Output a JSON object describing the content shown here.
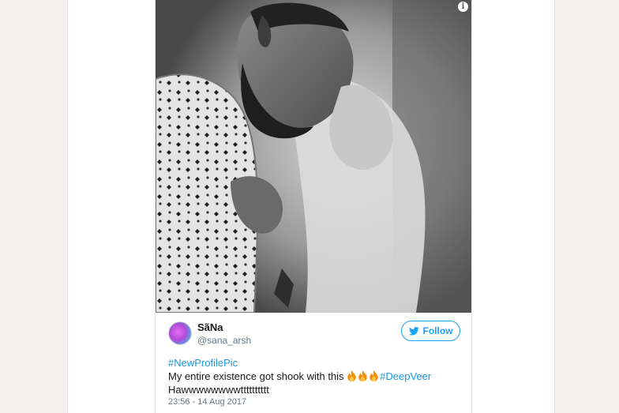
{
  "tweet": {
    "author": {
      "display_name": "SãNa",
      "handle": "@sana_arsh"
    },
    "follow_label": "Follow",
    "text": {
      "hashtag_1": "#NewProfilePic",
      "line_2": "My entire existence got shook with this ",
      "emoji": [
        "fire-icon",
        "fire-icon",
        "fire-icon"
      ],
      "hashtag_2": "#DeepVeer",
      "line_3": "Hawwwwwwwwtttttttttt"
    },
    "timestamp": "23:56 - 14 Aug 2017",
    "media_info_glyph": "i"
  },
  "colors": {
    "link": "#1b95e0",
    "follow_accent": "#1da1f2",
    "secondary_text": "#657786",
    "page_background": "#f6eeee"
  }
}
